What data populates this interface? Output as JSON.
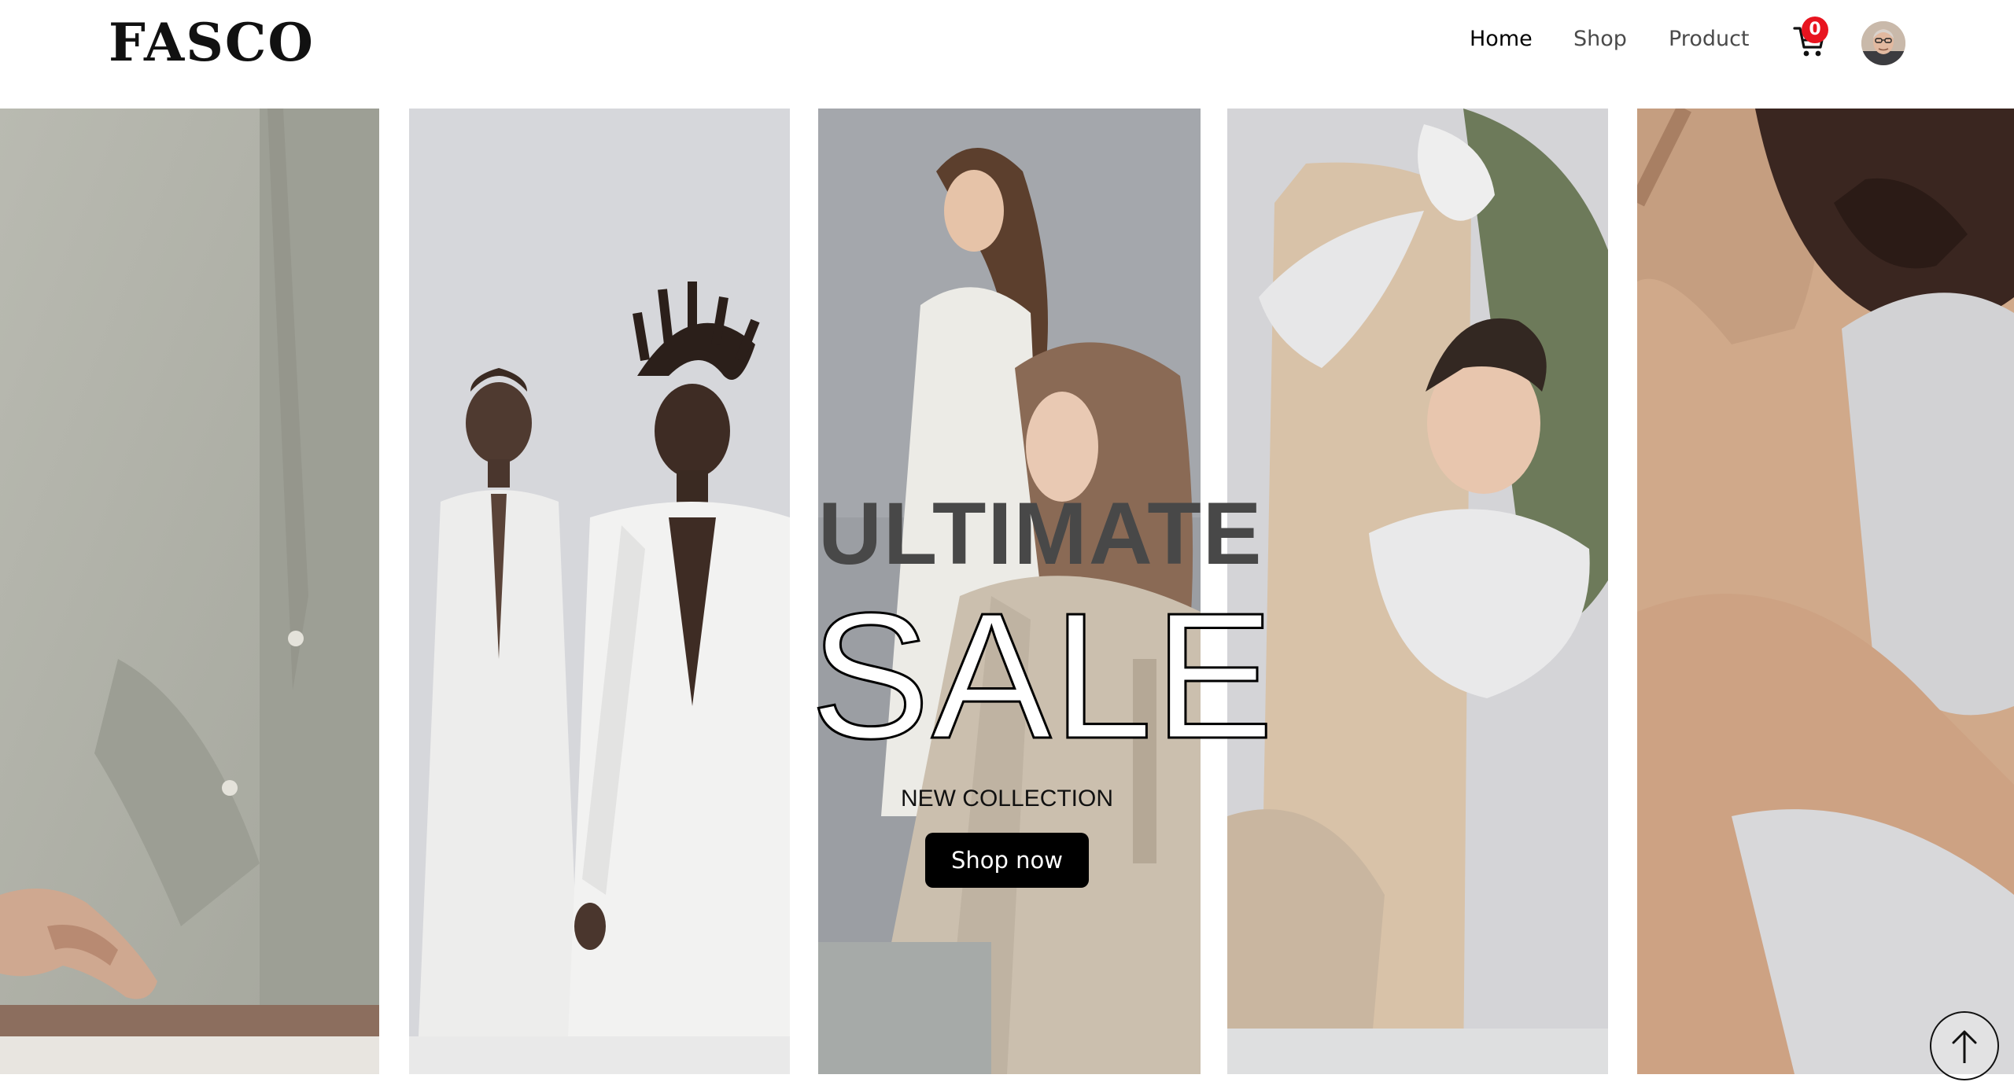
{
  "header": {
    "logo": "FASCO",
    "nav": {
      "home": "Home",
      "shop": "Shop",
      "product": "Product"
    },
    "cart": {
      "icon": "cart-icon",
      "count": "0"
    },
    "avatar_icon": "user-avatar"
  },
  "hero": {
    "headline": "ULTIMATE",
    "sale": "SALE",
    "subtitle": "NEW COLLECTION",
    "cta_label": "Shop now"
  },
  "scroll_top": {
    "icon": "arrow-up-icon"
  },
  "colors": {
    "badge": "#e8141f",
    "button": "#000000",
    "text": "#111111"
  }
}
